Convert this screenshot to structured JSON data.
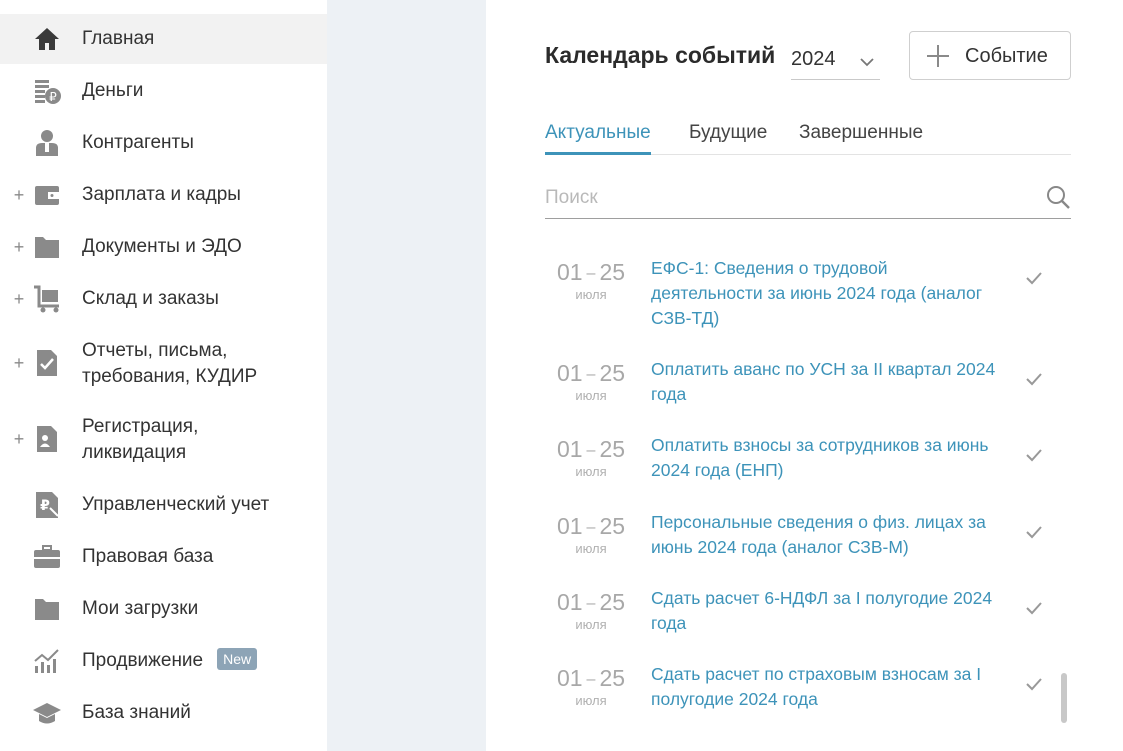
{
  "sidebar": {
    "items": [
      {
        "label": "Главная",
        "icon": "home-icon",
        "expandable": false,
        "active": true
      },
      {
        "label": "Деньги",
        "icon": "money-icon",
        "expandable": false
      },
      {
        "label": "Контрагенты",
        "icon": "contractor-icon",
        "expandable": false
      },
      {
        "label": "Зарплата и кадры",
        "icon": "wallet-icon",
        "expandable": true
      },
      {
        "label": "Документы и ЭДО",
        "icon": "folder-icon",
        "expandable": true
      },
      {
        "label": "Склад и заказы",
        "icon": "cart-icon",
        "expandable": true
      },
      {
        "label": "Отчеты, письма, требования, КУДИР",
        "icon": "report-icon",
        "expandable": true
      },
      {
        "label": "Регистрация, ликвидация",
        "icon": "registration-icon",
        "expandable": true
      },
      {
        "label": "Управленческий учет",
        "icon": "ruble-doc-icon",
        "expandable": false
      },
      {
        "label": "Правовая база",
        "icon": "briefcase-icon",
        "expandable": false
      },
      {
        "label": "Мои загрузки",
        "icon": "folder-icon",
        "expandable": false
      },
      {
        "label": "Продвижение",
        "icon": "growth-chart-icon",
        "expandable": false,
        "badge": "New"
      },
      {
        "label": "База знаний",
        "icon": "graduation-cap-icon",
        "expandable": false
      }
    ]
  },
  "main": {
    "title": "Календарь событий",
    "year": "2024",
    "add_button": "Событие",
    "tabs": [
      {
        "label": "Актуальные",
        "active": true
      },
      {
        "label": "Будущие"
      },
      {
        "label": "Завершенные"
      }
    ],
    "search_placeholder": "Поиск",
    "events": [
      {
        "from": "01",
        "to": "25",
        "month": "июля",
        "title": "ЕФС-1: Сведения о трудовой деятельности за июнь 2024 года (аналог СЗВ-ТД)"
      },
      {
        "from": "01",
        "to": "25",
        "month": "июля",
        "title": "Оплатить аванс по УСН за II квартал 2024 года"
      },
      {
        "from": "01",
        "to": "25",
        "month": "июля",
        "title": "Оплатить взносы за сотрудников за июнь 2024 года (ЕНП)"
      },
      {
        "from": "01",
        "to": "25",
        "month": "июля",
        "title": "Персональные сведения о физ. лицах за июнь 2024 года (аналог СЗВ-М)"
      },
      {
        "from": "01",
        "to": "25",
        "month": "июля",
        "title": "Сдать расчет 6-НДФЛ за I полугодие 2024 года"
      },
      {
        "from": "01",
        "to": "25",
        "month": "июля",
        "title": "Сдать расчет по страховым взносам за I полугодие 2024 года"
      }
    ]
  },
  "colors": {
    "accent": "#3d93b9",
    "gutter": "#edf1f5",
    "badge": "#8da4b6",
    "icon": "#8a8a8a"
  }
}
